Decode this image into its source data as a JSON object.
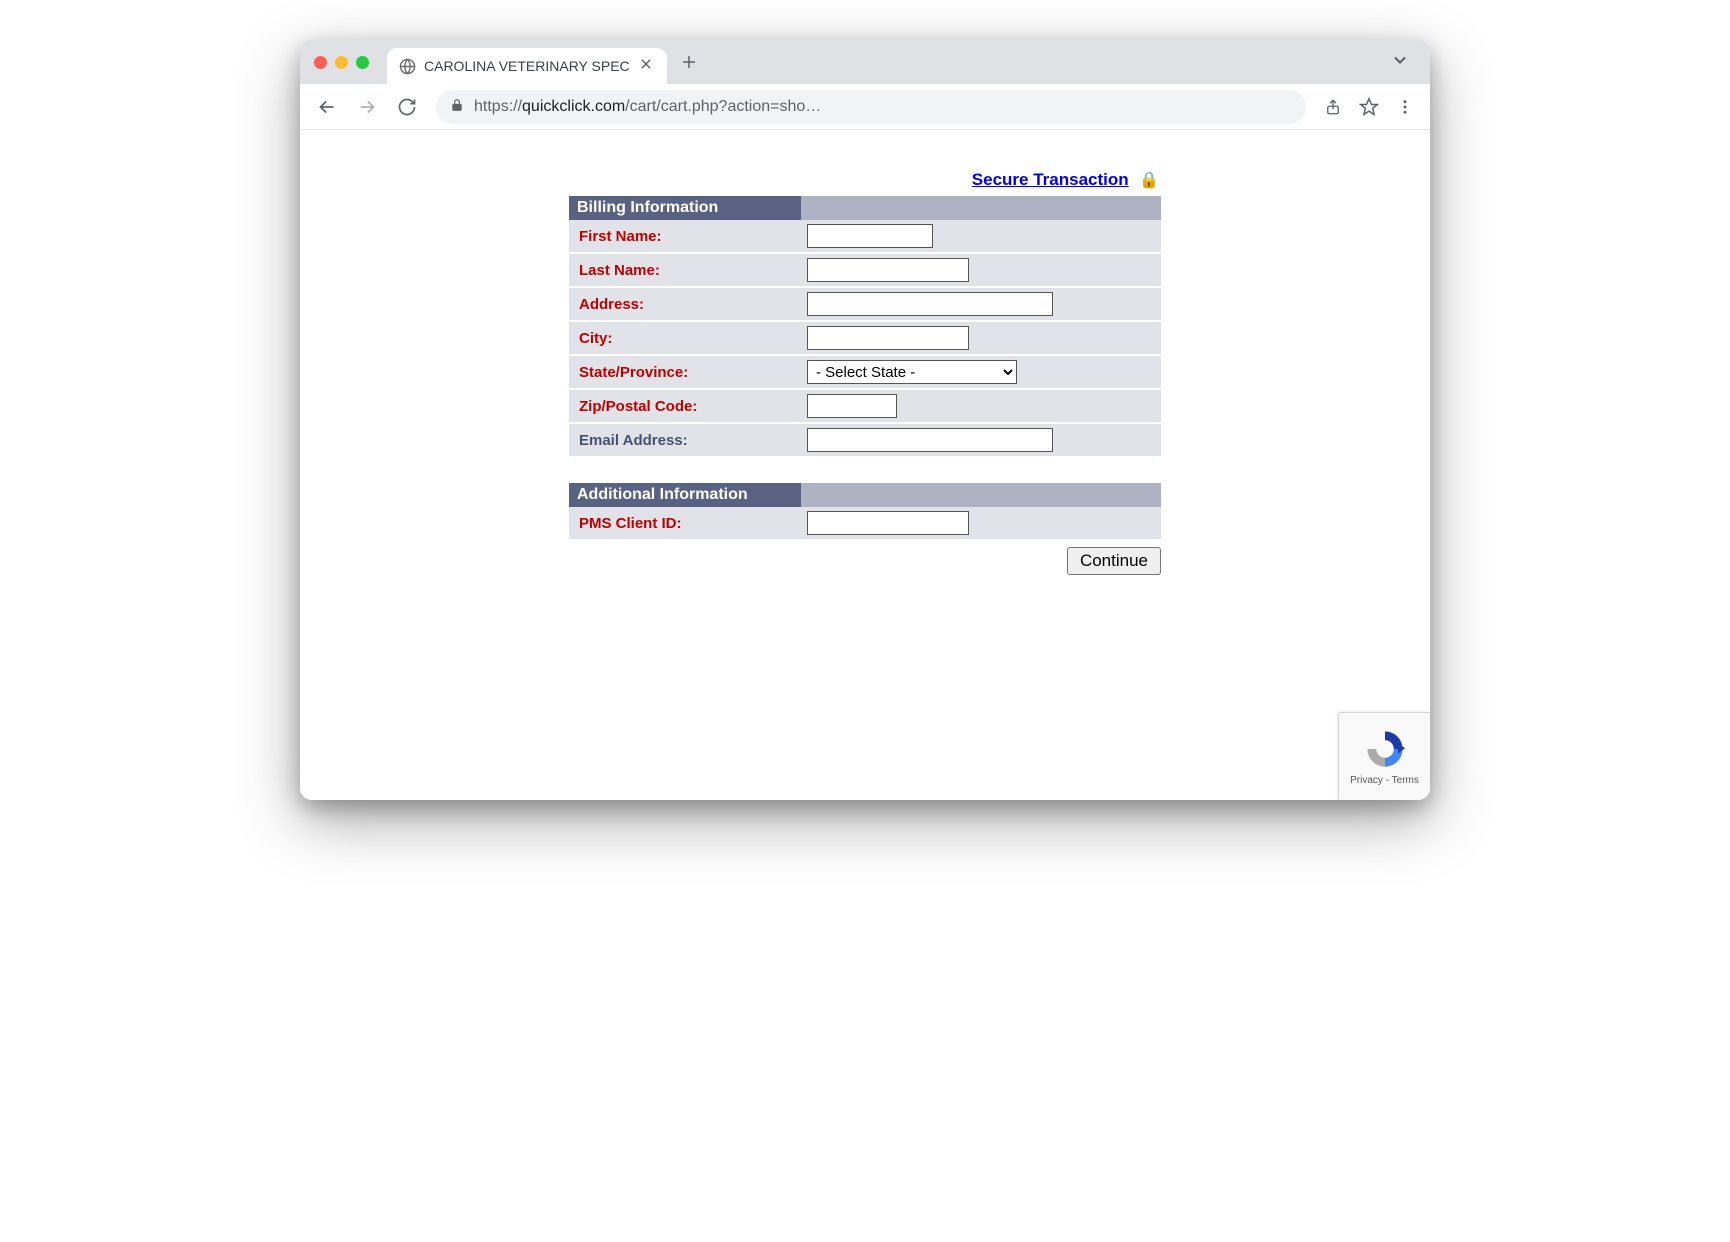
{
  "browser": {
    "tab_title": "CAROLINA VETERINARY SPECI",
    "url_prefix": "https://",
    "url_host": "quickclick.com",
    "url_path": "/cart/cart.php?action=sho…"
  },
  "page": {
    "secure_link": "Secure Transaction",
    "billing_header": "Billing Information",
    "additional_header": "Additional Information",
    "fields": {
      "first_name": "First Name:",
      "last_name": "Last Name:",
      "address": "Address:",
      "city": "City:",
      "state": "State/Province:",
      "state_placeholder": "- Select State -",
      "zip": "Zip/Postal Code:",
      "email": "Email Address:",
      "pms": "PMS Client ID:"
    },
    "continue": "Continue"
  },
  "recaptcha": {
    "privacy": "Privacy",
    "terms": "Terms",
    "sep": " - "
  }
}
